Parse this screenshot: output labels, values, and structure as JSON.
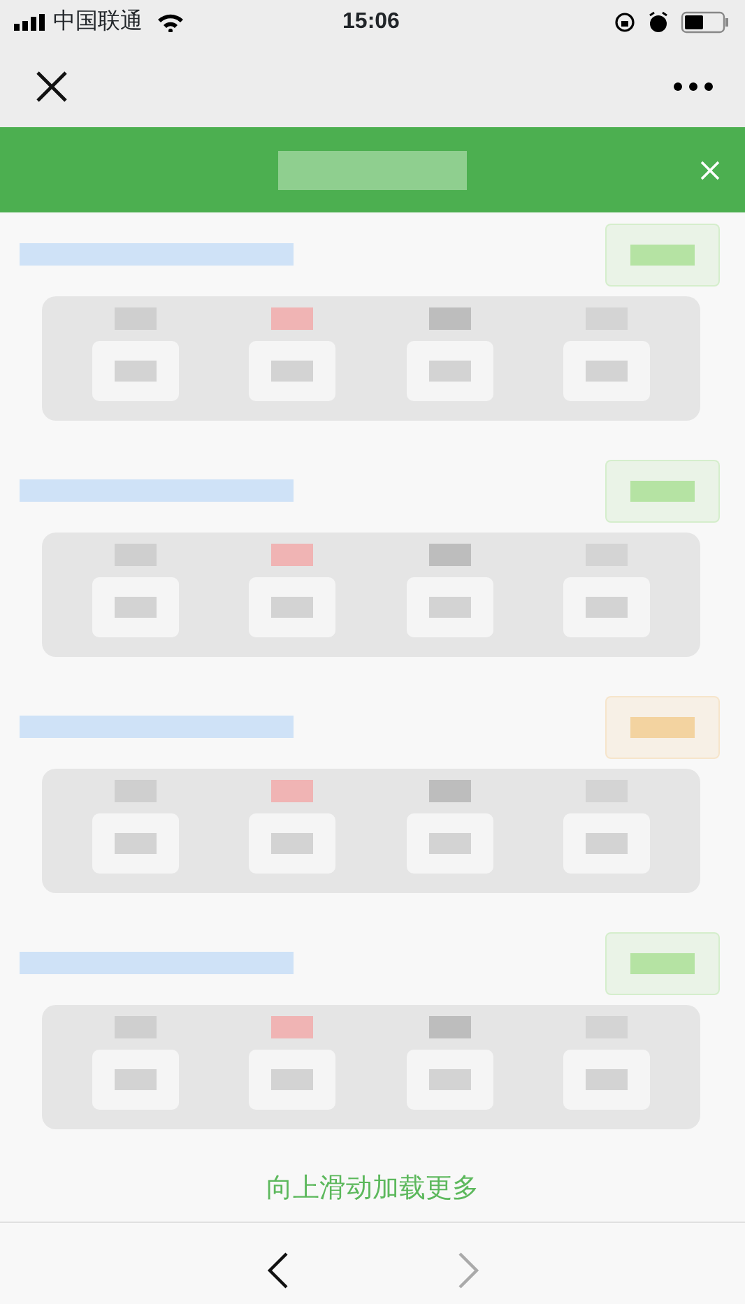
{
  "status_bar": {
    "carrier": "中国联通",
    "time": "15:06"
  },
  "records": [
    {
      "color": "#b5e3a3"
    },
    {
      "color": "#b5e3a3"
    },
    {
      "color": "#f3d3a0"
    },
    {
      "color": "#b5e3a3"
    }
  ],
  "footer": {
    "hint": "向上滑动加载更多"
  },
  "toolbar": {
    "back_disabled": false,
    "forward_disabled": true
  }
}
